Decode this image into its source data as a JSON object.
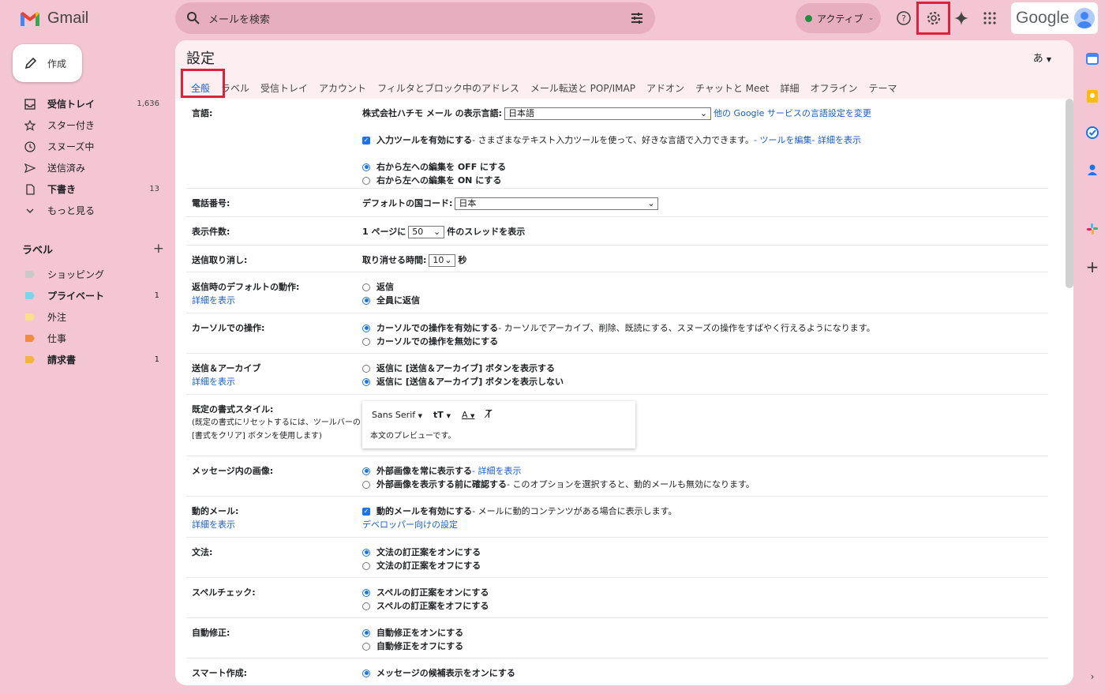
{
  "app": {
    "name": "Gmail"
  },
  "search": {
    "placeholder": "メールを検索"
  },
  "status": {
    "label": "アクティブ",
    "color": "#1e8e3e"
  },
  "brand": {
    "google": "Google"
  },
  "compose": {
    "label": "作成"
  },
  "nav": [
    {
      "icon": "inbox-icon",
      "label": "受信トレイ",
      "count": "1,636",
      "bold": true
    },
    {
      "icon": "star-icon",
      "label": "スター付き",
      "count": "",
      "bold": false
    },
    {
      "icon": "snooze-icon",
      "label": "スヌーズ中",
      "count": "",
      "bold": false
    },
    {
      "icon": "send-icon",
      "label": "送信済み",
      "count": "",
      "bold": false
    },
    {
      "icon": "draft-icon",
      "label": "下書き",
      "count": "13",
      "bold": true
    },
    {
      "icon": "chevron-down-icon",
      "label": "もっと見る",
      "count": "",
      "bold": false
    }
  ],
  "labels": {
    "title": "ラベル",
    "items": [
      {
        "label": "ショッピング",
        "color": "#c9c9c9",
        "count": "",
        "bold": false
      },
      {
        "label": "プライベート",
        "color": "#7fd3e8",
        "count": "1",
        "bold": true
      },
      {
        "label": "外注",
        "color": "#fbe08a",
        "count": "",
        "bold": false
      },
      {
        "label": "仕事",
        "color": "#f28b42",
        "count": "",
        "bold": false
      },
      {
        "label": "請求書",
        "color": "#f7b23b",
        "count": "1",
        "bold": true
      }
    ]
  },
  "settings": {
    "title": "設定",
    "input_lang": "あ",
    "tabs": [
      "全般",
      "ラベル",
      "受信トレイ",
      "アカウント",
      "フィルタとブロック中のアドレス",
      "メール転送と POP/IMAP",
      "アドオン",
      "チャットと Meet",
      "詳細",
      "オフライン",
      "テーマ"
    ],
    "rows": {
      "language": {
        "label": "言語:",
        "display_prefix": "株式会社ハチモ メール の表示言語:",
        "display_value": "日本語",
        "other_link": "他の Google サービスの言語設定を変更",
        "input_tools": "入力ツールを有効にする",
        "input_tools_desc": " - さまざまなテキスト入力ツールを使って、好きな言語で入力できます。",
        "edit_tools": " - ツールを編集",
        "learn_more": " - 詳細を表示",
        "rtl_off": "右から左への編集を OFF にする",
        "rtl_on": "右から左への編集を ON にする"
      },
      "phone": {
        "label": "電話番号:",
        "prefix": "デフォルトの国コード:",
        "value": "日本"
      },
      "page_size": {
        "label": "表示件数:",
        "prefix": "1 ページに",
        "value": "50",
        "suffix": "件のスレッドを表示"
      },
      "undo": {
        "label": "送信取り消し:",
        "prefix": "取り消せる時間:",
        "value": "10",
        "suffix": "秒"
      },
      "reply": {
        "label": "返信時のデフォルトの動作:",
        "link": "詳細を表示",
        "opt1": "返信",
        "opt2": "全員に返信"
      },
      "hover": {
        "label": "カーソルでの操作:",
        "opt1": "カーソルでの操作を有効にする",
        "opt1_desc": " - カーソルでアーカイブ、削除、既読にする、スヌーズの操作をすばやく行えるようになります。",
        "opt2": "カーソルでの操作を無効にする"
      },
      "send_archive": {
        "label": "送信＆アーカイブ",
        "link": "詳細を表示",
        "opt1": "返信に [送信＆アーカイブ] ボタンを表示する",
        "opt2": "返信に [送信＆アーカイブ] ボタンを表示しない"
      },
      "text_style": {
        "label": "既定の書式スタイル:",
        "sub1": "(既定の書式にリセットするには、ツールバーの",
        "sub2": "[書式をクリア] ボタンを使用します)",
        "font": "Sans Serif",
        "preview": "本文のプレビューです。"
      },
      "images": {
        "label": "メッセージ内の画像:",
        "opt1": "外部画像を常に表示する",
        "opt1_link": " - 詳細を表示",
        "opt2": "外部画像を表示する前に確認する",
        "opt2_desc": " - このオプションを選択すると、動的メールも無効になります。"
      },
      "dynamic": {
        "label": "動的メール:",
        "link": "詳細を表示",
        "opt1": "動的メールを有効にする",
        "opt1_desc": " - メールに動的コンテンツがある場合に表示します。",
        "dev_link": "デベロッパー向けの設定"
      },
      "grammar": {
        "label": "文法:",
        "opt1": "文法の訂正案をオンにする",
        "opt2": "文法の訂正案をオフにする"
      },
      "spelling": {
        "label": "スペルチェック:",
        "opt1": "スペルの訂正案をオンにする",
        "opt2": "スペルの訂正案をオフにする"
      },
      "autocorrect": {
        "label": "自動修正:",
        "opt1": "自動修正をオンにする",
        "opt2": "自動修正をオフにする"
      },
      "smart_compose": {
        "label": "スマート作成:",
        "opt1": "メッセージの候補表示をオンにする"
      }
    }
  },
  "colors": {
    "background": "#f4c6d4",
    "accent": "#1a73e8",
    "highlight": "#d9233b"
  }
}
